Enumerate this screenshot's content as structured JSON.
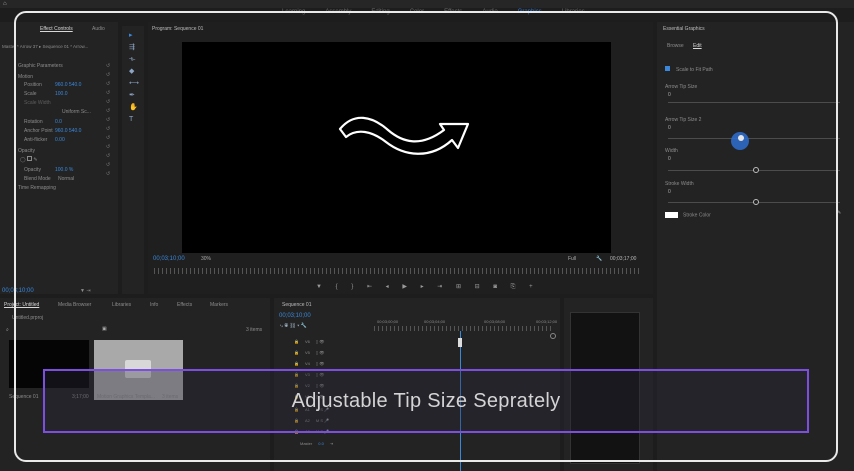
{
  "workspaces": [
    "Learning",
    "Assembly",
    "Editing",
    "Color",
    "Effects",
    "Audio",
    "Graphics",
    "Libraries"
  ],
  "active_workspace": "Graphics",
  "effect_controls": {
    "tabs": [
      "Effect Controls",
      "Audio"
    ],
    "active_tab": "Effect Controls",
    "clip_path": "Master * Arrow 37 ▸ Sequence 01 * Arrow...",
    "rows": [
      {
        "label": "Graphic Parameters",
        "value": ""
      },
      {
        "label": "Motion",
        "value": ""
      },
      {
        "label": "Position",
        "value": "960.0  540.0"
      },
      {
        "label": "Scale",
        "value": "100.0"
      },
      {
        "label": "Scale Width",
        "value": ""
      },
      {
        "label": "Uniform Sc...",
        "value": ""
      },
      {
        "label": "Rotation",
        "value": "0.0"
      },
      {
        "label": "Anchor Point",
        "value": "960.0  540.0"
      },
      {
        "label": "Anti-flicker",
        "value": "0.00"
      },
      {
        "label": "Opacity",
        "value": ""
      },
      {
        "label": "Opacity",
        "value": "100.0 %"
      },
      {
        "label": "Blend Mode",
        "value": "Normal"
      },
      {
        "label": "Time Remapping",
        "value": ""
      }
    ],
    "timecode": "00;03;10;00"
  },
  "program_monitor": {
    "title": "Program: Sequence 01",
    "timecode_left": "00;03;10;00",
    "zoom": "30%",
    "quality": "Full",
    "timecode_right": "00;03;17;00"
  },
  "project_panel": {
    "tabs": [
      "Project: Untitled",
      "Media Browser",
      "Libraries",
      "Info",
      "Effects",
      "Markers"
    ],
    "project_name": "Untitled.prproj",
    "items_count": "3 items",
    "seq_name": "Sequence 01",
    "seq_duration": "3;17;00",
    "bin_name": "Motion Graphics Templa...",
    "bin_items": "3 items"
  },
  "timeline": {
    "title": "Sequence 01",
    "timecode": "00;03;10;00",
    "ruler_labels": [
      "00;03;00;00",
      "00;03;04;00",
      "00;03;08;00",
      "00;03;12;00"
    ],
    "tracks": [
      "V6",
      "V5",
      "V4",
      "V3",
      "V2",
      "V1",
      "A1",
      "A2",
      "A3",
      "Master"
    ],
    "master_value": "0.0"
  },
  "essential_graphics": {
    "title": "Essential Graphics",
    "tabs": [
      "Browse",
      "Edit"
    ],
    "active_tab": "Edit",
    "checkbox_label": "Scale to Fit Path",
    "params": [
      {
        "label": "Arrow Tip Size",
        "value": "0",
        "fill": 0.0
      },
      {
        "label": "Arrow Tip Size 2",
        "value": "0",
        "fill": 0.6
      },
      {
        "label": "Width",
        "value": "0",
        "fill": 0.55
      },
      {
        "label": "Stroke Width",
        "value": "0",
        "fill": 0.55
      }
    ],
    "stroke_color_label": "Stroke Color"
  },
  "caption": "Adjustable Tip Size Seprately",
  "colors": {
    "accent": "#2f7cd9",
    "caption_border": "#7d4fe0",
    "frame": "#e9e9e9"
  }
}
